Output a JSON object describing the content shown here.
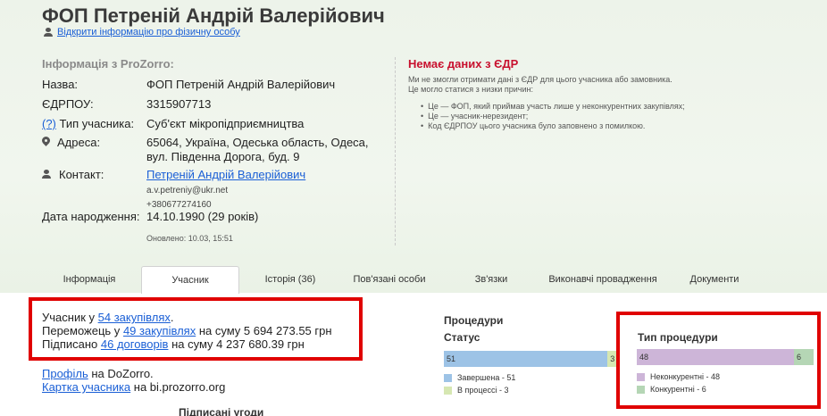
{
  "header": {
    "title": "ФОП Петреній Андрій Валерійович",
    "open_person_link": "Відкрити інформацію про фізичну особу"
  },
  "info": {
    "section_title": "Інформація з ProZorro:",
    "name_label": "Назва:",
    "name_value": "ФОП Петреній Андрій Валерійович",
    "edrpou_label": "ЄДРПОУ:",
    "edrpou_value": "3315907713",
    "type_help": "(?)",
    "type_label": "Тип учасника:",
    "type_value": "Суб'єкт мікропідприємництва",
    "address_label": "Адреса:",
    "address_line1": "65064, Україна, Одеська область, Одеса,",
    "address_line2": "вул. Південна Дорога, буд. 9",
    "contact_label": "Контакт:",
    "contact_name": "Петреній Андрій Валерійович",
    "contact_email": "a.v.petreniy@ukr.net",
    "contact_phone": "+380677274160",
    "birth_label": "Дата народження:",
    "birth_value": "14.10.1990 (29 років)",
    "updated": "Оновлено: 10.03, 15:51"
  },
  "edr": {
    "title": "Немає даних з ЄДР",
    "line1": "Ми не змогли отримати дані з ЄДР для цього учасника або замовника.",
    "line2": "Це могло статися з низки причин:",
    "reasons": [
      "Це — ФОП, який приймав участь лише у неконкурентних закупівлях;",
      "Це — учасник-нерезидент;",
      "Код ЄДРПОУ цього учасника було заповнено з помилкою."
    ]
  },
  "tabs": [
    {
      "label": "Інформація",
      "active": false
    },
    {
      "label": "Учасник",
      "active": true
    },
    {
      "label": "Історія (36)",
      "active": false
    },
    {
      "label": "Пов'язані особи",
      "active": false
    },
    {
      "label": "Зв'язки",
      "active": false
    },
    {
      "label": "Виконавчі провадження",
      "active": false
    },
    {
      "label": "Документи",
      "active": false
    }
  ],
  "summary": {
    "participant_prefix": "Учасник у ",
    "participant_link": "54 закупівлях",
    "participant_suffix": ".",
    "winner_prefix": "Переможець у ",
    "winner_link": "49 закупівлях",
    "winner_suffix": " на суму 5 694 273.55 грн",
    "signed_prefix": "Підписано ",
    "signed_link": "46 договорів",
    "signed_suffix": " на суму 4 237 680.39 грн"
  },
  "links": {
    "profile_link": "Профіль",
    "profile_suffix": " на DoZorro.",
    "card_link": "Картка учасника",
    "card_suffix": " на bi.prozorro.org"
  },
  "signed_contracts_title": "Підписані угоди",
  "procedures": {
    "title": "Процедури",
    "status_title": "Статус",
    "type_title": "Тип процедури"
  },
  "colors": {
    "completed": "#9dc3e6",
    "in_process": "#d6e7b2",
    "non_competitive": "#cdb5d8",
    "competitive": "#b5d6b5",
    "highlight": "#e00000"
  },
  "chart_data": [
    {
      "type": "bar",
      "title": "Статус",
      "orientation": "horizontal-stacked",
      "series": [
        {
          "name": "Завершена",
          "value": 51,
          "color": "#9dc3e6"
        },
        {
          "name": "В процессі",
          "value": 3,
          "color": "#d6e7b2"
        }
      ],
      "legend": [
        "Завершена - 51",
        "В процессі - 3"
      ]
    },
    {
      "type": "bar",
      "title": "Тип процедури",
      "orientation": "horizontal-stacked",
      "series": [
        {
          "name": "Неконкурентні",
          "value": 48,
          "color": "#cdb5d8"
        },
        {
          "name": "Конкурентні",
          "value": 6,
          "color": "#b5d6b5"
        }
      ],
      "legend": [
        "Неконкурентні - 48",
        "Конкурентні - 6"
      ]
    }
  ]
}
